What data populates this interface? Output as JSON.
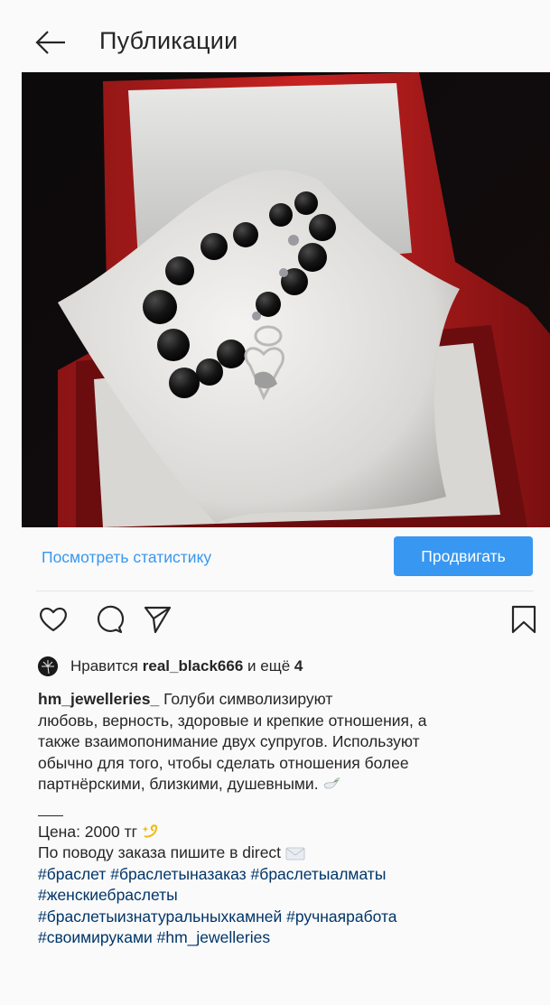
{
  "header": {
    "title": "Публикации",
    "back_icon": "arrow-left-icon"
  },
  "post": {
    "image_alt": "Bracelet on a white pillow in a red gift box",
    "stats_label": "Посмотреть статистику",
    "promote_label": "Продвигать",
    "icons": [
      "heart-icon",
      "comment-icon",
      "share-icon",
      "bookmark-icon"
    ],
    "likes": {
      "prefix": "Нравится",
      "user": "real_black666",
      "middle": "и ещё",
      "count": "4"
    },
    "caption": {
      "username": "hm_jewelleries_",
      "lines": [
        "Голуби символизируют",
        "любовь, верность, здоровые и крепкие отношения, а",
        "также взаимопонимание двух супругов. Используют",
        "обычно для того, чтобы сделать отношения более",
        "партнёрскими, близкими, душевными."
      ],
      "price": "Цена: 2000 тг",
      "order": "По поводу заказа пишите в direct",
      "hashtag_lines": [
        "#браслет #браслетыназаказ #браслетыалматы",
        "#женскиебраслеты",
        "#браслетыизнатуральныхкамней #ручнаяработа",
        "#своимируками #hm_jewelleries"
      ]
    }
  },
  "colors": {
    "accent": "#3897f0",
    "hashtag": "#003569",
    "text": "#262626"
  }
}
